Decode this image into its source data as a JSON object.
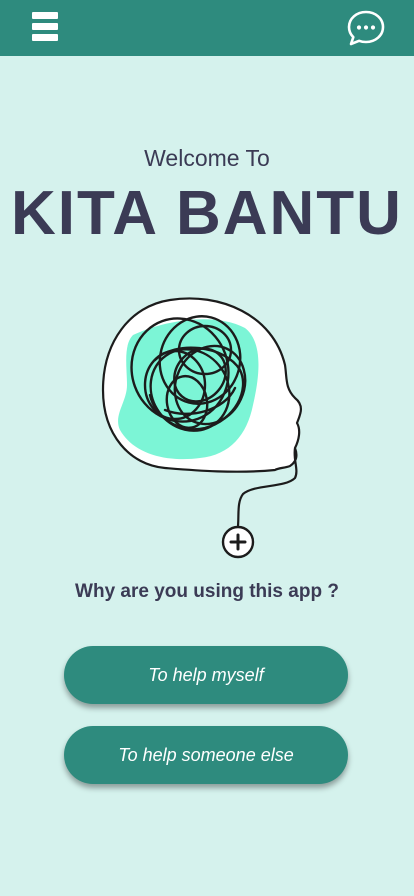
{
  "header": {
    "menu_icon": "hamburger-menu-icon",
    "chat_icon": "chat-bubble-icon"
  },
  "welcome": {
    "subtitle": "Welcome To",
    "title": "KITA BANTU"
  },
  "illustration": {
    "icon": "tangled-mind-head-icon",
    "accent": "#7cf5d6"
  },
  "question": "Why are you using this app ?",
  "buttons": {
    "help_myself": "To help myself",
    "help_someone_else": "To help someone else"
  },
  "colors": {
    "primary": "#2e8b7e",
    "background": "#d5f2ed",
    "text": "#3b3b55"
  }
}
